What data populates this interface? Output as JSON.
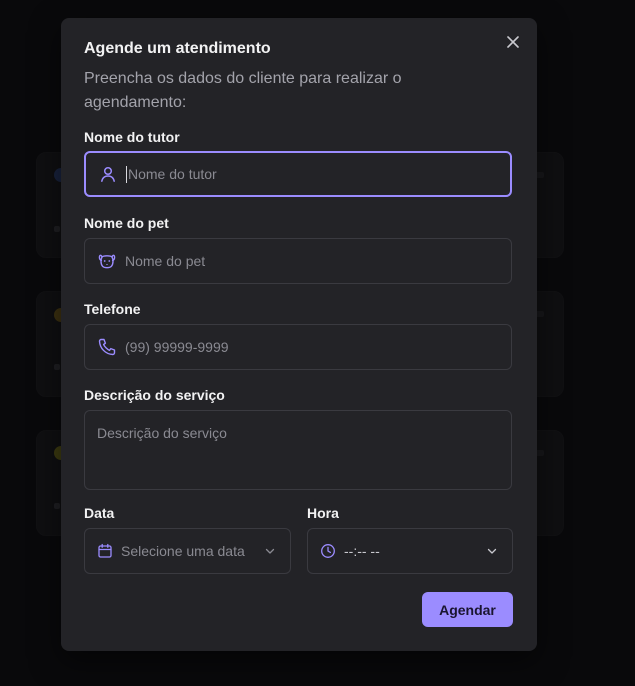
{
  "modal": {
    "title": "Agende um atendimento",
    "subtitle": "Preencha os dados do cliente para realizar o agendamento:",
    "close_icon": "close-icon",
    "fields": {
      "tutor": {
        "label": "Nome do tutor",
        "placeholder": "Nome do tutor",
        "value": "",
        "icon": "user-icon"
      },
      "pet": {
        "label": "Nome do pet",
        "placeholder": "Nome do pet",
        "value": "",
        "icon": "paw-icon"
      },
      "phone": {
        "label": "Telefone",
        "placeholder": "(99) 99999-9999",
        "value": "",
        "icon": "phone-icon"
      },
      "description": {
        "label": "Descrição do serviço",
        "placeholder": "Descrição do serviço",
        "value": ""
      },
      "date": {
        "label": "Data",
        "placeholder": "Selecione uma data",
        "icon": "calendar-icon"
      },
      "time": {
        "label": "Hora",
        "value": "--:-- --",
        "icon": "clock-icon"
      }
    },
    "submit_label": "Agendar"
  },
  "colors": {
    "accent": "#9b8cff",
    "modal_bg": "#232327",
    "page_bg": "#121214",
    "text_primary": "#f2f2f3",
    "text_muted": "#a3a3ab",
    "border": "#3a3a40"
  }
}
